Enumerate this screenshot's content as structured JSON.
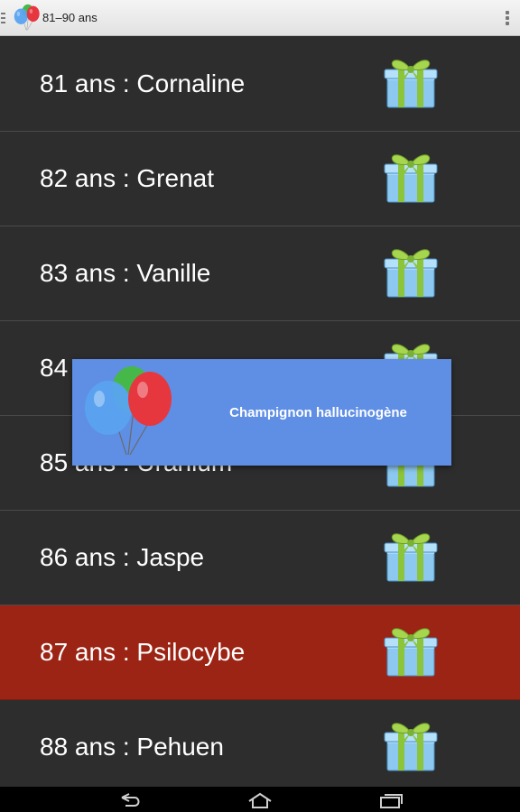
{
  "action_bar": {
    "title": "81–90 ans",
    "up_icon": "menu-drawer-icon",
    "app_icon": "balloons-icon",
    "overflow_icon": "overflow-menu-icon"
  },
  "list": {
    "items": [
      {
        "label": "81 ans : Cornaline",
        "selected": false,
        "icon": "gift-icon"
      },
      {
        "label": "82 ans : Grenat",
        "selected": false,
        "icon": "gift-icon"
      },
      {
        "label": "83 ans : Vanille",
        "selected": false,
        "icon": "gift-icon"
      },
      {
        "label": "84 ans : ",
        "selected": false,
        "icon": "gift-icon"
      },
      {
        "label": "85 ans : Uranium",
        "selected": false,
        "icon": "gift-icon"
      },
      {
        "label": "86 ans : Jaspe",
        "selected": false,
        "icon": "gift-icon"
      },
      {
        "label": "87 ans : Psilocybe",
        "selected": true,
        "icon": "gift-icon"
      },
      {
        "label": "88 ans : Pehuen",
        "selected": false,
        "icon": "gift-icon"
      }
    ]
  },
  "toast": {
    "text": "Champignon hallucinogène",
    "icon": "balloons-icon"
  },
  "colors": {
    "selected_row": "#9b2414",
    "toast_bg": "#5f8ee5",
    "list_bg": "#2d2d2d"
  },
  "nav_bar": {
    "back_icon": "back-icon",
    "home_icon": "home-icon",
    "recents_icon": "recent-apps-icon"
  }
}
